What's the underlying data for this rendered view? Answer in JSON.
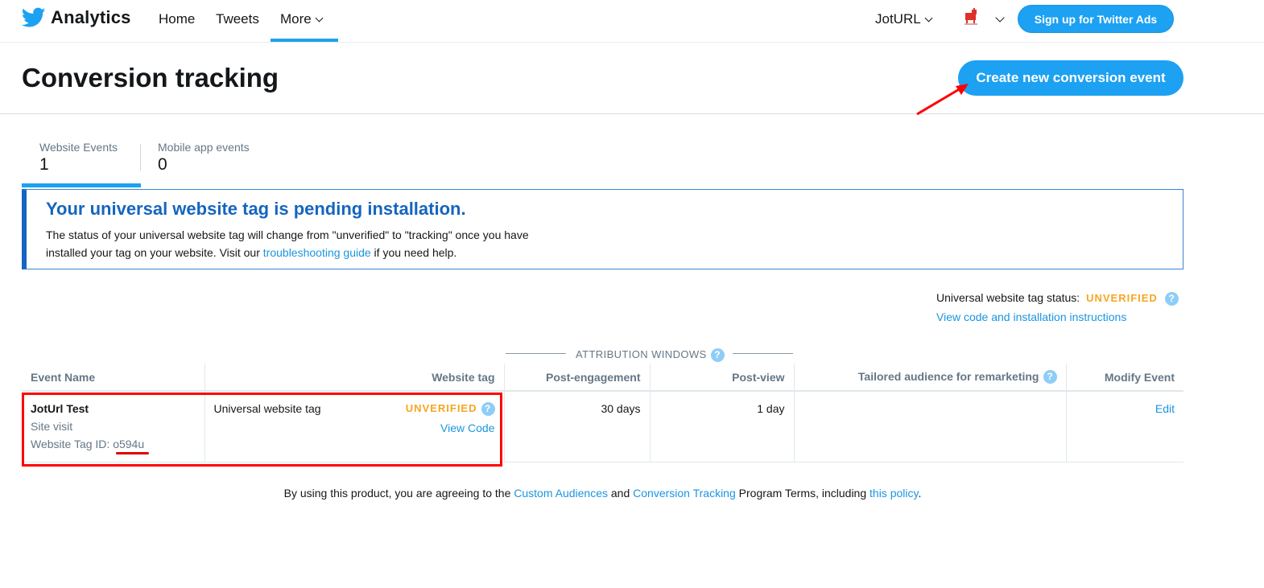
{
  "app": {
    "title": "Analytics",
    "colors": {
      "accent": "#1da1f2",
      "link": "#1b95e0",
      "alert_blue": "#1565c0",
      "warning": "#f5a623",
      "annotation_red": "#ff0000"
    }
  },
  "nav": {
    "home": "Home",
    "tweets": "Tweets",
    "more": "More",
    "account": "JotURL",
    "signup": "Sign up for Twitter Ads"
  },
  "header": {
    "title": "Conversion tracking",
    "create_button": "Create new conversion event"
  },
  "tabs": [
    {
      "label": "Website Events",
      "count": "1",
      "active": true
    },
    {
      "label": "Mobile app events",
      "count": "0",
      "active": false
    }
  ],
  "alert": {
    "title": "Your universal website tag is pending installation.",
    "text_1": "The status of your universal website tag will change from \"unverified\" to \"tracking\" once you have installed your tag on your website. Visit our ",
    "link": "troubleshooting guide",
    "text_2": " if you need help."
  },
  "status": {
    "label": "Universal website tag status:",
    "value": "UNVERIFIED",
    "help": "?",
    "link": "View code and installation instructions"
  },
  "attribution": {
    "label": "ATTRIBUTION WINDOWS",
    "help": "?"
  },
  "table": {
    "headers": {
      "event_name": "Event Name",
      "website_tag": "Website tag",
      "post_engagement": "Post-engagement",
      "post_view": "Post-view",
      "tailored": "Tailored audience for remarketing",
      "modify": "Modify Event"
    },
    "rows": [
      {
        "name": "JotUrl Test",
        "type": "Site visit",
        "tag_id_label": "Website Tag ID: ",
        "tag_id": "o594u",
        "website_tag": "Universal website tag",
        "tag_status": "UNVERIFIED",
        "view_code": "View Code",
        "post_engagement": "30 days",
        "post_view": "1 day",
        "tailored": "",
        "modify": "Edit"
      }
    ]
  },
  "footer": {
    "t1": "By using this product, you are agreeing to the ",
    "l1": "Custom Audiences",
    "t2": " and ",
    "l2": "Conversion Tracking",
    "t3": " Program Terms, including ",
    "l3": "this policy",
    "t4": "."
  }
}
